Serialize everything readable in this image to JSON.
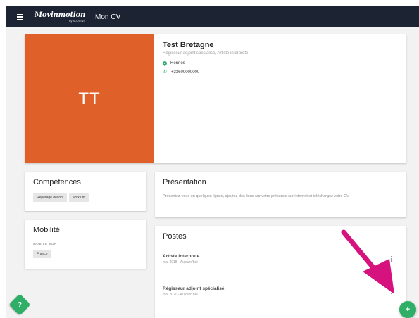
{
  "topbar": {
    "brand_name": "Movinmotion",
    "brand_sub": "by AUDIENS",
    "title": "Mon CV"
  },
  "profile": {
    "initials": "TT",
    "name": "Test Bretagne",
    "roles": "Régisseur adjoint spécialisé, Artiste interprète",
    "location": "Rennes",
    "phone": "+33600000000"
  },
  "skills": {
    "title": "Compétences",
    "items": [
      "Repérage décors",
      "Voix Off"
    ]
  },
  "presentation": {
    "title": "Présentation",
    "text": "Présentez-vous en quelques lignes, ajoutez des liens sur votre présence sur internet et téléchargez votre CV"
  },
  "mobility": {
    "title": "Mobilité",
    "label": "MOBILE SUR",
    "value": "France"
  },
  "postes": {
    "title": "Postes",
    "items": [
      {
        "title": "Artiste interprète",
        "dates": "mai 2018 - Aujourd'hui"
      },
      {
        "title": "Régisseur adjoint spécialisé",
        "dates": "mai 2020 - Aujourd'hui"
      }
    ]
  },
  "buttons": {
    "help": "?",
    "add": "+"
  },
  "colors": {
    "topbar": "#1c2433",
    "avatar": "#e0602a",
    "accent": "#2fae68",
    "annotation_arrow": "#d6127e"
  }
}
